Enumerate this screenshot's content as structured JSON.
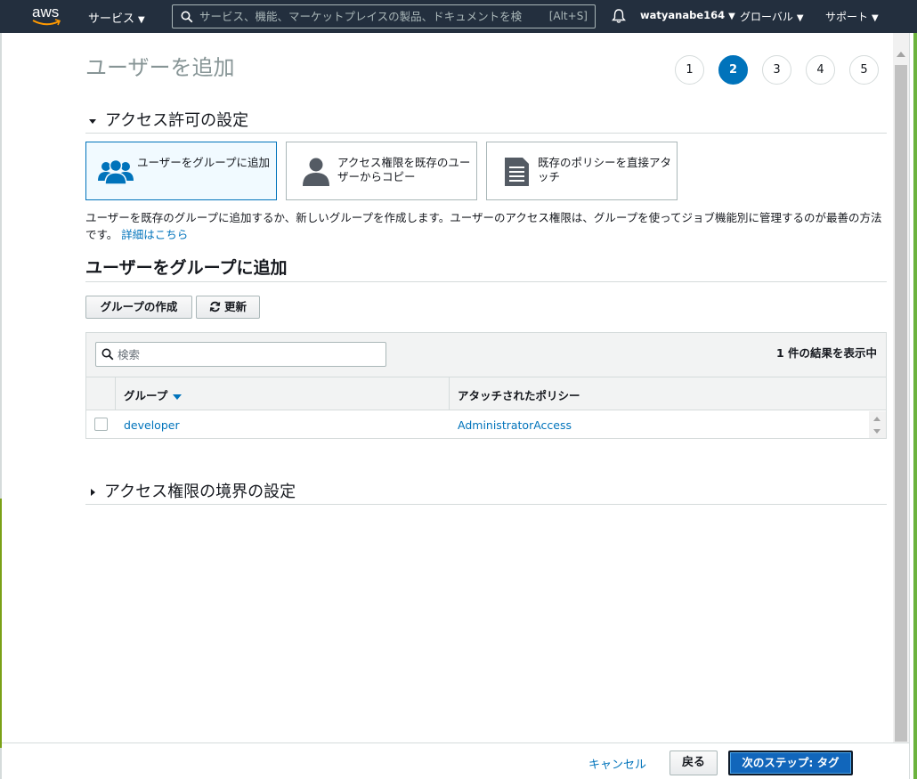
{
  "topnav": {
    "logo_text": "aws",
    "services_label": "サービス",
    "search_placeholder": "サービス、機能、マーケットプレイスの製品、ドキュメントを検",
    "search_hotkey": "[Alt+S]",
    "user": "watyanabe164",
    "region": "グローバル",
    "support": "サポート",
    "icons": [
      "search-icon",
      "bell-icon",
      "caret-down-icon"
    ]
  },
  "page": {
    "title": "ユーザーを追加",
    "steps": [
      "1",
      "2",
      "3",
      "4",
      "5"
    ],
    "active_step": 2
  },
  "permissions": {
    "section_title": "アクセス許可の設定",
    "options": [
      {
        "label": "ユーザーをグループに追加",
        "icon": "users-group-icon",
        "selected": true
      },
      {
        "label": "アクセス権限を既存のユーザーからコピー",
        "icon": "user-icon",
        "selected": false
      },
      {
        "label": "既存のポリシーを直接アタッチ",
        "icon": "document-icon",
        "selected": false
      }
    ],
    "description": "ユーザーを既存のグループに追加するか、新しいグループを作成します。ユーザーのアクセス権限は、グループを使ってジョブ機能別に管理するのが最善の方法です。",
    "learn_more": "詳細はこちら"
  },
  "groups": {
    "title": "ユーザーをグループに追加",
    "create_button": "グループの作成",
    "refresh_button": "更新",
    "search_placeholder": "検索",
    "result_count": "1 件の結果を表示中",
    "columns": [
      "グループ",
      "アタッチされたポリシー"
    ],
    "rows": [
      {
        "group": "developer",
        "policy": "AdministratorAccess",
        "checked": false
      }
    ]
  },
  "boundary": {
    "section_title": "アクセス権限の境界の設定"
  },
  "footer": {
    "cancel": "キャンセル",
    "back": "戻る",
    "next": "次のステップ: タグ"
  },
  "colors": {
    "nav_bg": "#232f3e",
    "accent": "#0073bb",
    "primary_button": "#1166bb",
    "tile_selected_bg": "#f1faff"
  }
}
